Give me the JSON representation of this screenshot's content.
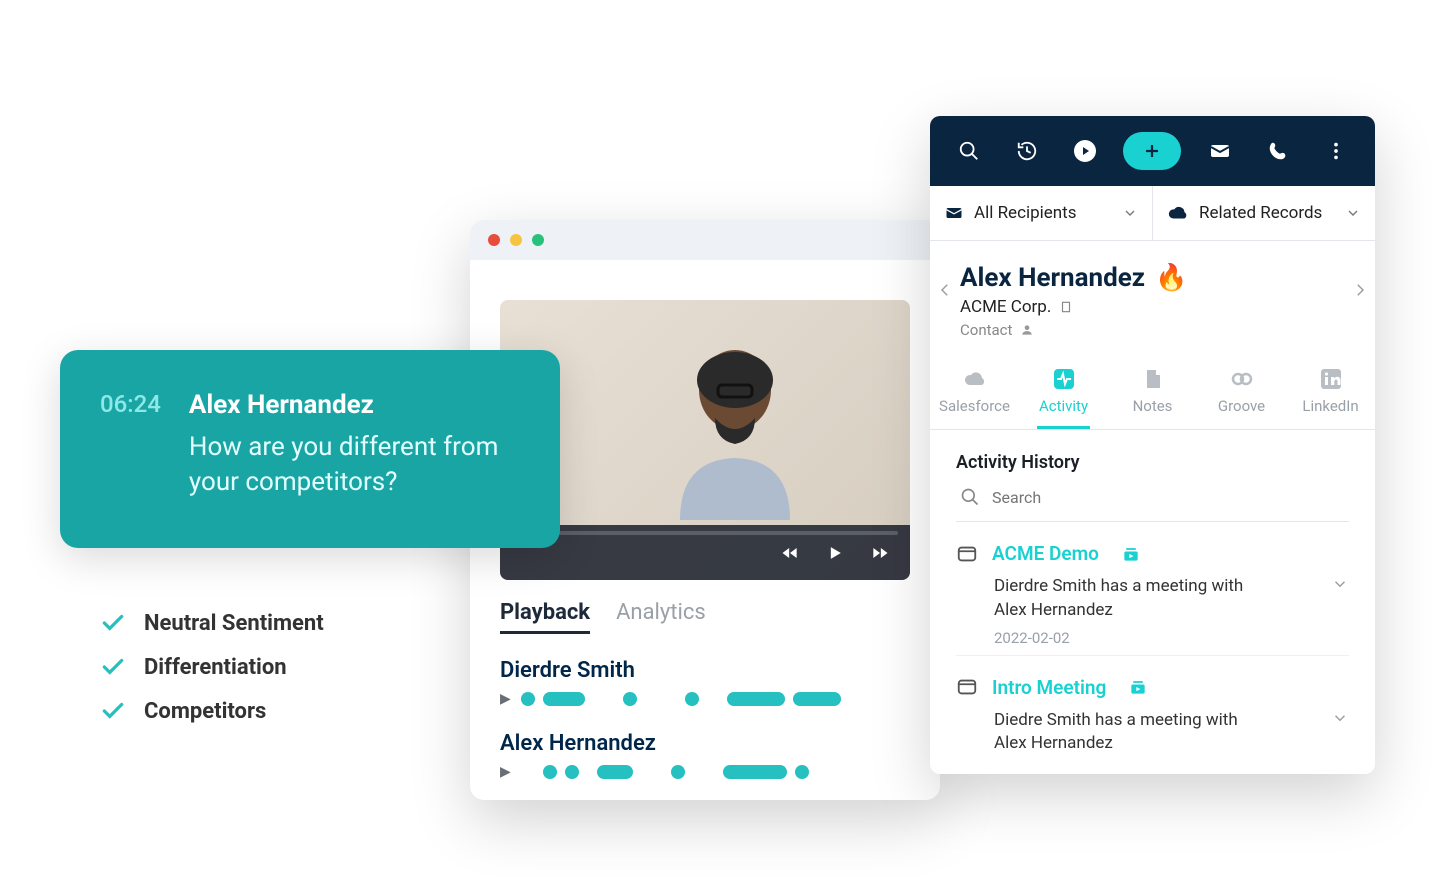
{
  "transcript": {
    "timestamp": "06:24",
    "speaker": "Alex Hernandez",
    "quote": "How are you different from your competitors?"
  },
  "tags": [
    "Neutral Sentiment",
    "Differentiation",
    "Competitors"
  ],
  "video": {
    "tabs": {
      "playback": "Playback",
      "analytics": "Analytics"
    },
    "speakers": [
      "Dierdre Smith",
      "Alex Hernandez"
    ]
  },
  "side": {
    "selectors": {
      "recipients": "All Recipients",
      "records": "Related Records"
    },
    "contact": {
      "name": "Alex Hernandez",
      "fire": "🔥",
      "company": "ACME Corp.",
      "type": "Contact"
    },
    "tabs": [
      "Salesforce",
      "Activity",
      "Notes",
      "Groove",
      "LinkedIn"
    ],
    "history": {
      "title": "Activity History",
      "search_placeholder": "Search",
      "items": [
        {
          "title": "ACME Demo",
          "desc": "Dierdre Smith has a meeting with Alex Hernandez",
          "date": "2022-02-02"
        },
        {
          "title": "Intro Meeting",
          "desc": "Diedre Smith has a meeting with Alex Hernandez"
        }
      ]
    }
  }
}
